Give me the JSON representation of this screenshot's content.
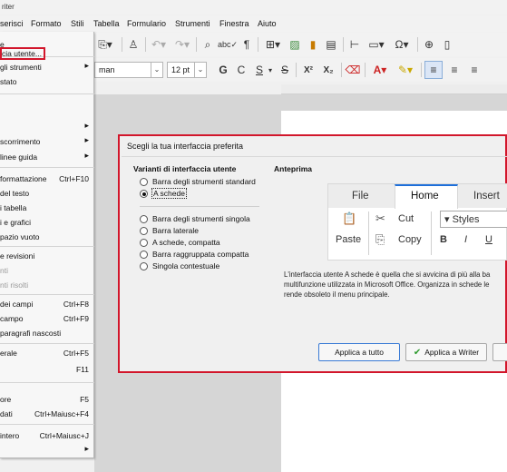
{
  "window": {
    "title": "riter"
  },
  "menubar": {
    "items": [
      {
        "label": "serisci"
      },
      {
        "label": "Formato"
      },
      {
        "label": "Stili"
      },
      {
        "label": "Tabella"
      },
      {
        "label": "Formulario"
      },
      {
        "label": "Strumenti"
      },
      {
        "label": "Finestra"
      },
      {
        "label": "Aiuto"
      }
    ]
  },
  "toolbar": {
    "font_name": "man",
    "font_size": "12 pt",
    "bold": "G",
    "italic": "C",
    "underline": "S",
    "strikethrough": "S",
    "superscript": "X²",
    "subscript": "X₂"
  },
  "view_menu": {
    "items": [
      {
        "label": "e",
        "shortcut": "",
        "submenu": false,
        "disabled": false
      },
      {
        "label": "cia utente...",
        "shortcut": "",
        "submenu": false,
        "disabled": false,
        "highlighted": true
      },
      {
        "label": "gli strumenti",
        "shortcut": "",
        "submenu": true,
        "disabled": false
      },
      {
        "label": "stato",
        "shortcut": "",
        "submenu": false,
        "disabled": false
      },
      {
        "label": "",
        "shortcut": "",
        "submenu": true,
        "disabled": false
      },
      {
        "label": "scorrimento",
        "shortcut": "",
        "submenu": true,
        "disabled": false
      },
      {
        "label": "linee guida",
        "shortcut": "",
        "submenu": true,
        "disabled": false
      },
      {
        "label": "formattazione",
        "shortcut": "Ctrl+F10",
        "submenu": false,
        "disabled": false
      },
      {
        "label": "del testo",
        "shortcut": "",
        "submenu": false,
        "disabled": false
      },
      {
        "label": "i tabella",
        "shortcut": "",
        "submenu": false,
        "disabled": false
      },
      {
        "label": "i e grafici",
        "shortcut": "",
        "submenu": false,
        "disabled": false
      },
      {
        "label": "pazio vuoto",
        "shortcut": "",
        "submenu": false,
        "disabled": false
      },
      {
        "label": "e revisioni",
        "shortcut": "",
        "submenu": false,
        "disabled": false
      },
      {
        "label": "nti",
        "shortcut": "",
        "submenu": false,
        "disabled": true
      },
      {
        "label": "nti risolti",
        "shortcut": "",
        "submenu": false,
        "disabled": true
      },
      {
        "label": "dei campi",
        "shortcut": "Ctrl+F8",
        "submenu": false,
        "disabled": false
      },
      {
        "label": "campo",
        "shortcut": "Ctrl+F9",
        "submenu": false,
        "disabled": false
      },
      {
        "label": "paragrafi nascosti",
        "shortcut": "",
        "submenu": false,
        "disabled": false
      },
      {
        "label": "erale",
        "shortcut": "Ctrl+F5",
        "submenu": false,
        "disabled": false
      },
      {
        "label": "",
        "shortcut": "F11",
        "submenu": false,
        "disabled": false
      },
      {
        "label": "ore",
        "shortcut": "F5",
        "submenu": false,
        "disabled": false
      },
      {
        "label": "dati",
        "shortcut": "Ctrl+Maiusc+F4",
        "submenu": false,
        "disabled": false
      },
      {
        "label": "intero",
        "shortcut": "Ctrl+Maiusc+J",
        "submenu": false,
        "disabled": false
      },
      {
        "label": "",
        "shortcut": "",
        "submenu": true,
        "disabled": false
      }
    ]
  },
  "dialog": {
    "title": "Scegli la tua interfaccia preferita",
    "variants_heading": "Varianti di interfaccia utente",
    "preview_heading": "Anteprima",
    "options": [
      {
        "label": "Barra degli strumenti standard",
        "selected": false
      },
      {
        "label": "A schede",
        "selected": true
      },
      {
        "label": "Barra degli strumenti singola",
        "selected": false
      },
      {
        "label": "Barra laterale",
        "selected": false
      },
      {
        "label": "A schede, compatta",
        "selected": false
      },
      {
        "label": "Barra raggruppata compatta",
        "selected": false
      },
      {
        "label": "Singola contestuale",
        "selected": false
      }
    ],
    "preview": {
      "tabs": [
        "File",
        "Home",
        "Insert"
      ],
      "active_tab": "Home",
      "cut": "Cut",
      "copy": "Copy",
      "paste": "Paste",
      "styles": "Styles",
      "bold": "B",
      "italic": "I",
      "underline": "U"
    },
    "description": [
      "L'interfaccia utente A schede è quella che si avvicina di più alla ba",
      "multifunzione utilizzata in Microsoft Office. Organizza in schede le",
      "rende obsoleto il menu principale."
    ],
    "buttons": {
      "apply_all": "Applica a tutto",
      "apply_writer": "Applica a Writer"
    },
    "accent_color": "#d2162b"
  }
}
